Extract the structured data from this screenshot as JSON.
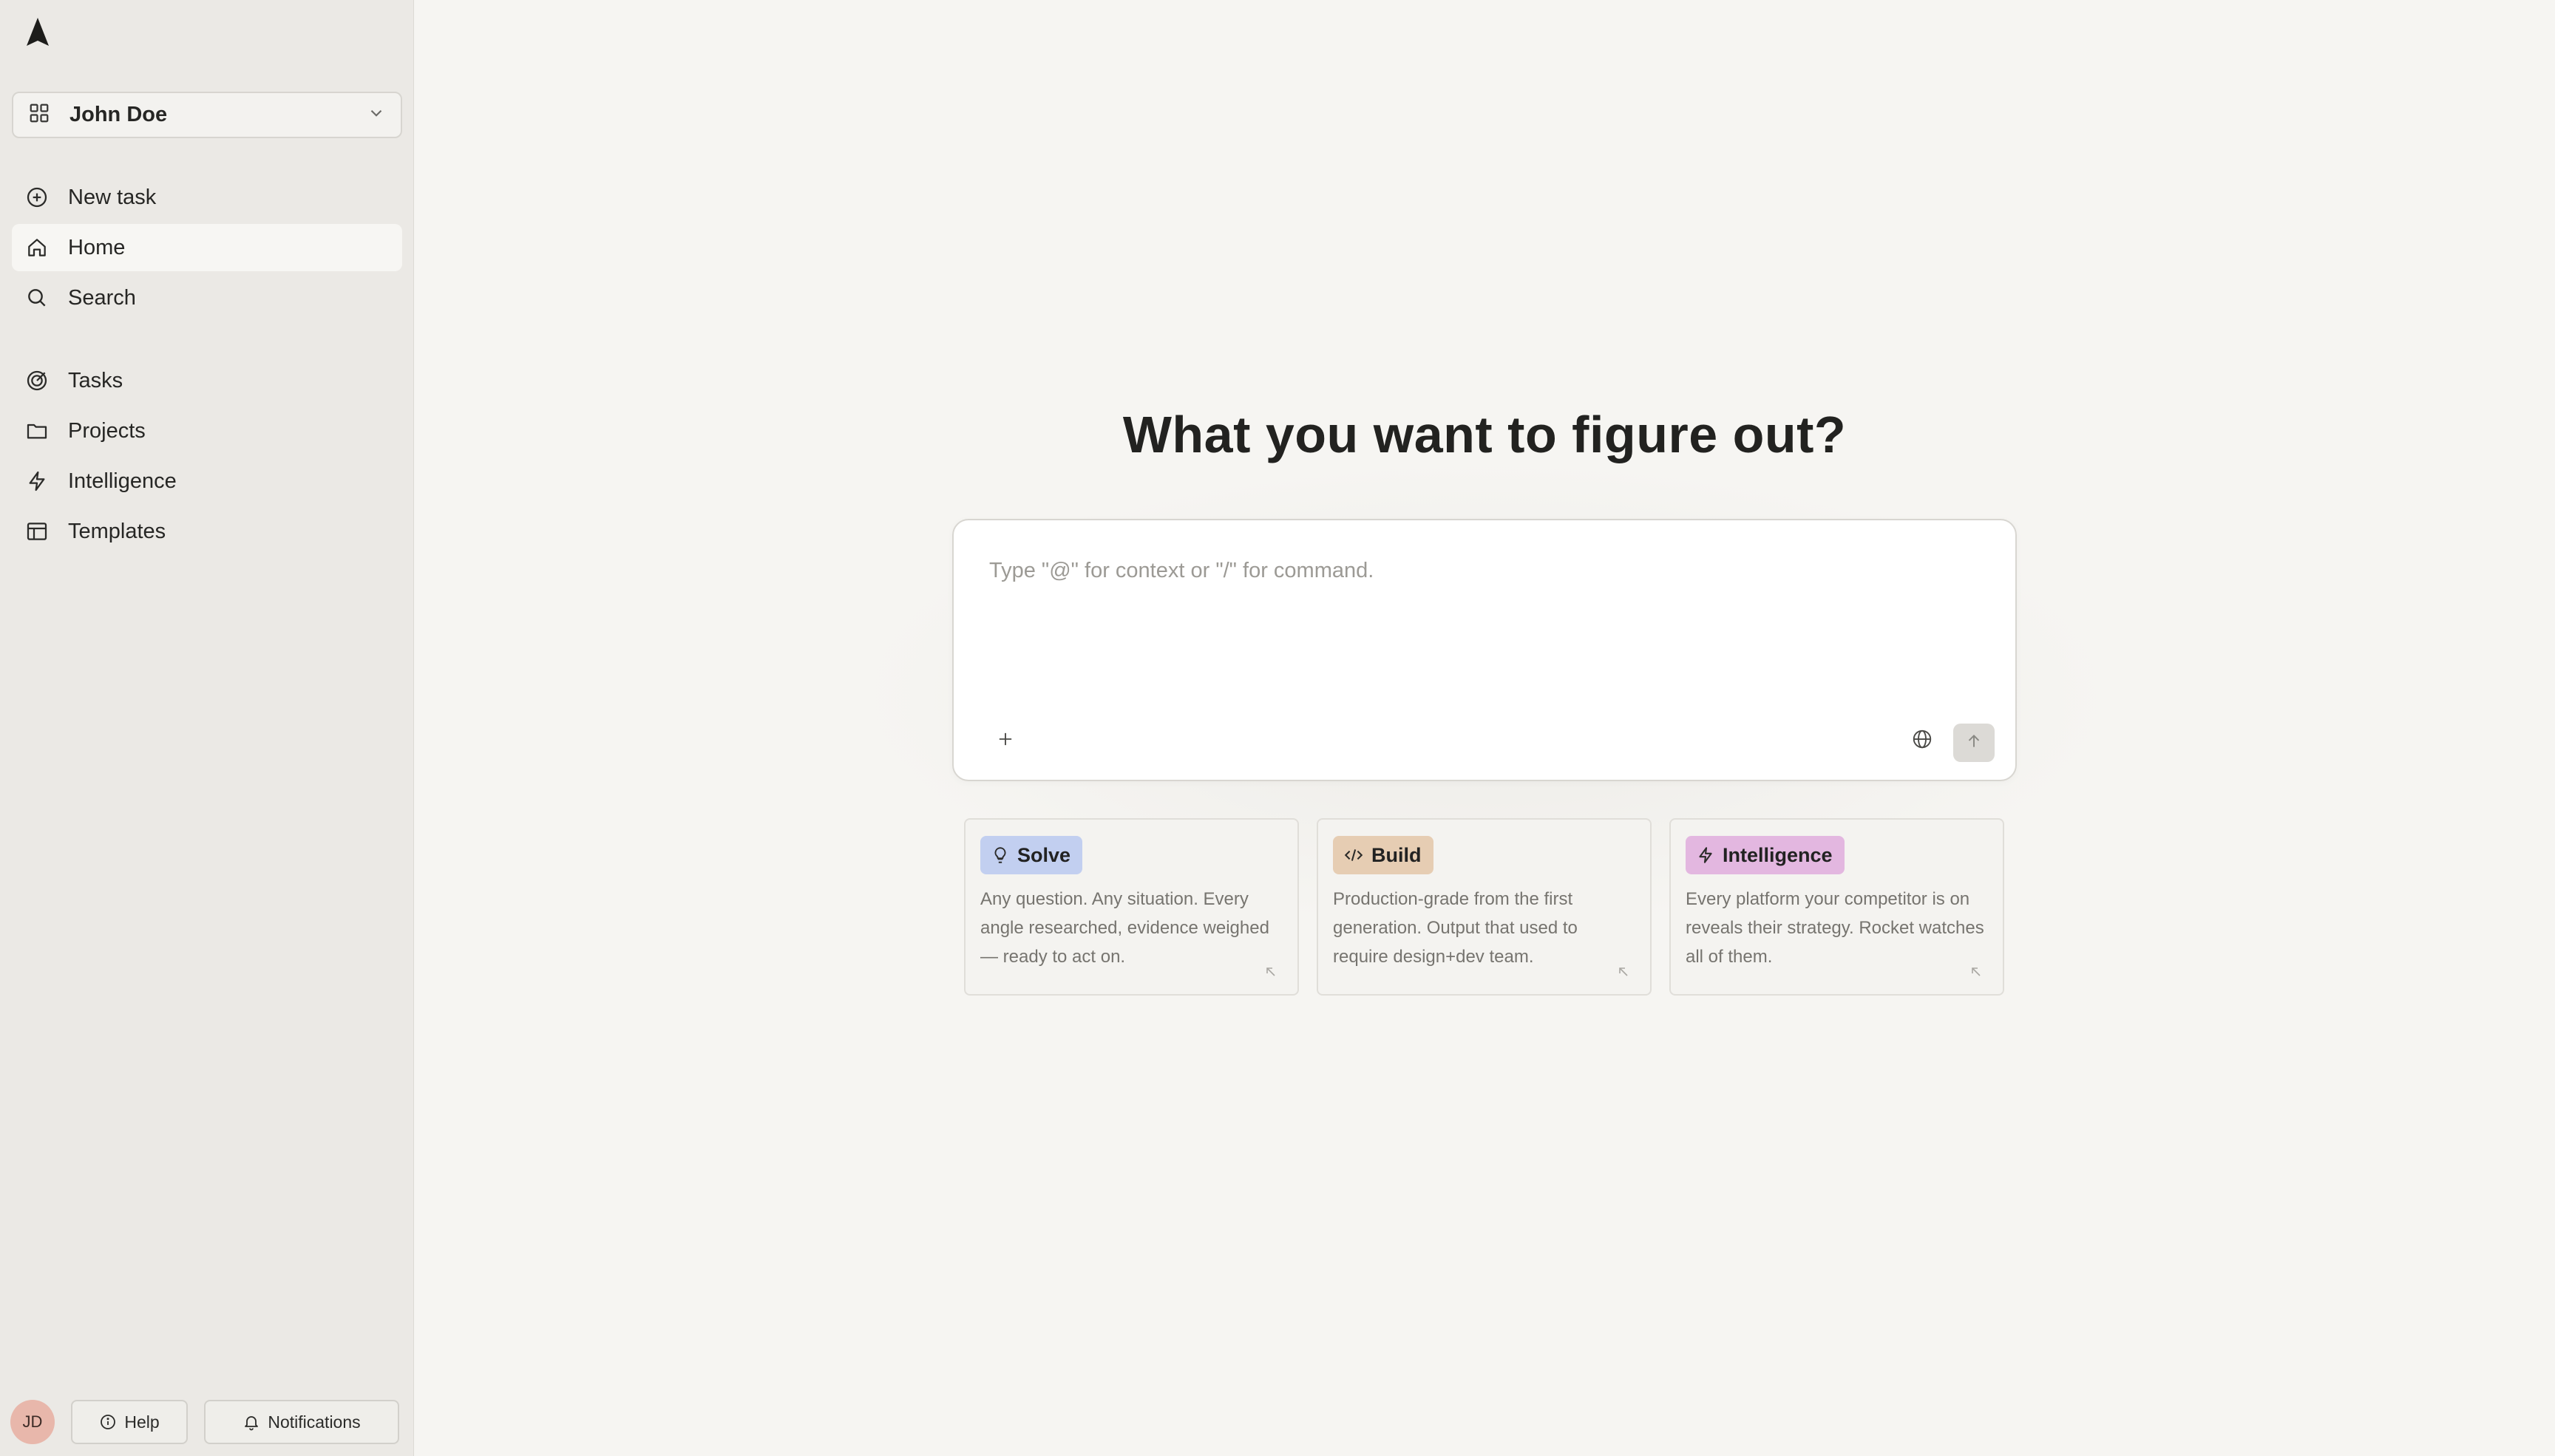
{
  "sidebar": {
    "workspace": {
      "name": "John Doe"
    },
    "primary_items": [
      {
        "label": "New task",
        "icon": "plus-circle-icon"
      },
      {
        "label": "Home",
        "icon": "home-icon",
        "active": true
      },
      {
        "label": "Search",
        "icon": "search-icon"
      }
    ],
    "secondary_items": [
      {
        "label": "Tasks",
        "icon": "target-icon"
      },
      {
        "label": "Projects",
        "icon": "folder-icon"
      },
      {
        "label": "Intelligence",
        "icon": "bolt-icon"
      },
      {
        "label": "Templates",
        "icon": "layout-icon"
      }
    ],
    "footer": {
      "avatar_initials": "JD",
      "help_label": "Help",
      "notifications_label": "Notifications"
    }
  },
  "main": {
    "headline": "What you want to figure out?",
    "composer": {
      "placeholder": "Type \"@\" for context or \"/\" for command.",
      "value": ""
    },
    "cards": [
      {
        "tag": "Solve",
        "icon": "lightbulb-icon",
        "tag_color": "#c2cff0",
        "description": "Any question. Any situation. Every angle researched, evidence weighed — ready to act on."
      },
      {
        "tag": "Build",
        "icon": "code-icon",
        "tag_color": "#e6cdb3",
        "description": "Production-grade from the first generation. Output that used to require design+dev team."
      },
      {
        "tag": "Intelligence",
        "icon": "bolt-icon",
        "tag_color": "#e3b7e0",
        "description": "Every platform your competitor is on reveals their strategy. Rocket watches all of them."
      }
    ]
  },
  "colors": {
    "background": "#f6f5f2",
    "sidebar": "#ebe9e5",
    "active_item": "#f7f6f3",
    "avatar": "#e8b7ab"
  }
}
